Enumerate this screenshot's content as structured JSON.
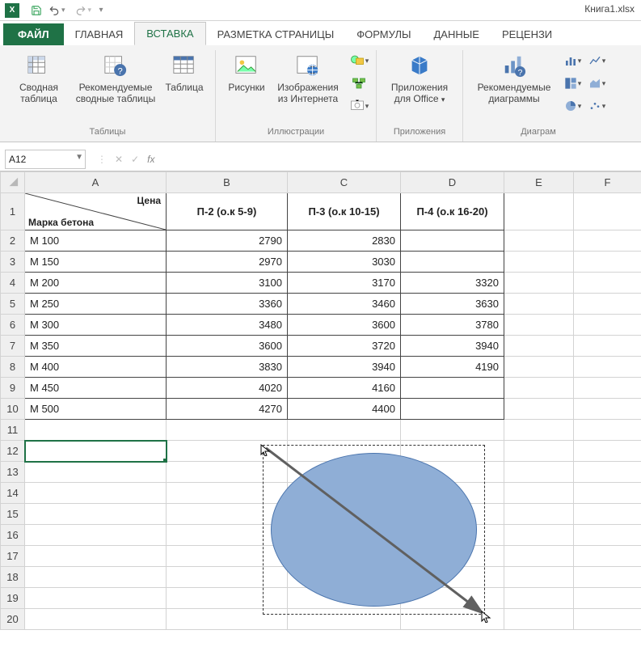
{
  "window": {
    "title": "Книга1.xlsx"
  },
  "qat": {
    "save_tooltip": "Сохранить",
    "undo_tooltip": "Отменить",
    "redo_tooltip": "Вернуть"
  },
  "tabs": {
    "file": "ФАЙЛ",
    "home": "ГЛАВНАЯ",
    "insert": "ВСТАВКА",
    "pagelayout": "РАЗМЕТКА СТРАНИЦЫ",
    "formulas": "ФОРМУЛЫ",
    "data": "ДАННЫЕ",
    "review": "РЕЦЕНЗИ"
  },
  "ribbon": {
    "groups": {
      "tables": {
        "label": "Таблицы",
        "pivot": "Сводная таблица",
        "recpivot": "Рекомендуемые сводные таблицы",
        "table": "Таблица"
      },
      "illustrations": {
        "label": "Иллюстрации",
        "pictures": "Рисунки",
        "online_images": "Изображения из Интернета"
      },
      "apps": {
        "label": "Приложения",
        "office_apps": "Приложения для Office"
      },
      "charts": {
        "label": "Диаграм",
        "recommended_charts": "Рекомендуемые диаграммы"
      }
    }
  },
  "formula_bar": {
    "name_box": "A12",
    "cancel": "✕",
    "enter": "✓",
    "fx": "fx",
    "value": ""
  },
  "columns": [
    "A",
    "B",
    "C",
    "D",
    "E",
    "F"
  ],
  "rows": [
    "1",
    "2",
    "3",
    "4",
    "5",
    "6",
    "7",
    "8",
    "9",
    "10",
    "11",
    "12",
    "13",
    "14",
    "15",
    "16",
    "17",
    "18",
    "19",
    "20"
  ],
  "header_cell": {
    "top": "Цена",
    "bottom": "Марка бетона"
  },
  "col_headers": {
    "b": "П-2 (о.к 5-9)",
    "c": "П-3 (о.к 10-15)",
    "d": "П-4 (о.к 16-20)"
  },
  "data_rows": [
    {
      "a": "М 100",
      "b": "2790",
      "c": "2830",
      "d": ""
    },
    {
      "a": "М 150",
      "b": "2970",
      "c": "3030",
      "d": ""
    },
    {
      "a": "М 200",
      "b": "3100",
      "c": "3170",
      "d": "3320"
    },
    {
      "a": "М 250",
      "b": "3360",
      "c": "3460",
      "d": "3630"
    },
    {
      "a": "М 300",
      "b": "3480",
      "c": "3600",
      "d": "3780"
    },
    {
      "a": "М 350",
      "b": "3600",
      "c": "3720",
      "d": "3940"
    },
    {
      "a": "М 400",
      "b": "3830",
      "c": "3940",
      "d": "4190"
    },
    {
      "a": "М 450",
      "b": "4020",
      "c": "4160",
      "d": ""
    },
    {
      "a": "М 500",
      "b": "4270",
      "c": "4400",
      "d": ""
    }
  ],
  "selected_cell": "A12",
  "colors": {
    "accent": "#1f7246",
    "shape_fill": "#8faed6",
    "shape_border": "#4a74ad"
  },
  "chart_data": {
    "type": "table",
    "title": "Цена / Марка бетона",
    "columns": [
      "Марка бетона",
      "П-2 (о.к 5-9)",
      "П-3 (о.к 10-15)",
      "П-4 (о.к 16-20)"
    ],
    "rows": [
      [
        "М 100",
        2790,
        2830,
        null
      ],
      [
        "М 150",
        2970,
        3030,
        null
      ],
      [
        "М 200",
        3100,
        3170,
        3320
      ],
      [
        "М 250",
        3360,
        3460,
        3630
      ],
      [
        "М 300",
        3480,
        3600,
        3780
      ],
      [
        "М 350",
        3600,
        3720,
        3940
      ],
      [
        "М 400",
        3830,
        3940,
        4190
      ],
      [
        "М 450",
        4020,
        4160,
        null
      ],
      [
        "М 500",
        4270,
        4400,
        null
      ]
    ]
  }
}
